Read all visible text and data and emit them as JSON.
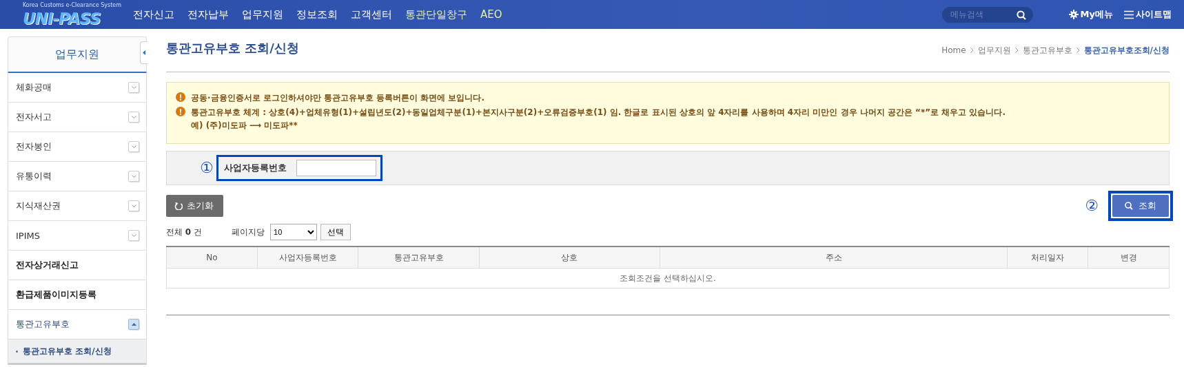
{
  "header": {
    "logo": {
      "tagline": "Korea Customs e-Clearance System",
      "name": "UNI-PASS"
    },
    "nav": [
      {
        "label": "전자신고",
        "highlight": false
      },
      {
        "label": "전자납부",
        "highlight": false
      },
      {
        "label": "업무지원",
        "highlight": false
      },
      {
        "label": "정보조회",
        "highlight": false
      },
      {
        "label": "고객센터",
        "highlight": false
      },
      {
        "label": "통관단일창구",
        "highlight": true
      },
      {
        "label": "AEO",
        "highlight": true
      }
    ],
    "search": {
      "placeholder": "메뉴검색"
    },
    "my_menu": "My메뉴",
    "sitemap": "사이트맵"
  },
  "sidebar": {
    "title": "업무지원",
    "items": [
      {
        "label": "체화공매",
        "kind": "expandable",
        "expanded": false
      },
      {
        "label": "전자서고",
        "kind": "expandable",
        "expanded": false
      },
      {
        "label": "전자봉인",
        "kind": "expandable",
        "expanded": false
      },
      {
        "label": "유통이력",
        "kind": "expandable",
        "expanded": false
      },
      {
        "label": "지식재산권",
        "kind": "expandable",
        "expanded": false
      },
      {
        "label": "IPIMS",
        "kind": "expandable",
        "expanded": false
      },
      {
        "label": "전자상거래신고",
        "kind": "link"
      },
      {
        "label": "환급제품이미지등록",
        "kind": "link"
      },
      {
        "label": "통관고유부호",
        "kind": "expandable",
        "expanded": true,
        "children": [
          {
            "label": "통관고유부호 조회/신청",
            "selected": true
          }
        ]
      }
    ]
  },
  "page": {
    "title": "통관고유부호 조회/신청",
    "breadcrumb": [
      {
        "label": "Home",
        "current": false
      },
      {
        "label": "업무지원",
        "current": false
      },
      {
        "label": "통관고유부호",
        "current": false
      },
      {
        "label": "통관고유부호조회/신청",
        "current": true
      }
    ],
    "notices": [
      {
        "lines": [
          "공동·금융인증서로 로그인하셔야만 통관고유부호 등록버튼이 화면에 보입니다."
        ]
      },
      {
        "lines": [
          "통관고유부호 체계 : 상호(4)+업체유형(1)+설립년도(2)+동일업체구분(1)+본지사구분(2)+오류검증부호(1) 임. 한글로 표시된 상호의 앞 4자리를 사용하며 4자리 미만인 경우 나머지 공간은 “*”로 채우고 있습니다.",
          "예) (주)미도파 ⟶ 미도파**"
        ]
      }
    ],
    "search_form": {
      "marker": "①",
      "label": "사업자등록번호"
    },
    "reset_button": "초기화",
    "search_marker": "②",
    "search_button": "조회",
    "total": "전체 **0** 건",
    "per_page_label": "페이지당",
    "per_page_value": "10",
    "select_button": "선택",
    "table": {
      "columns": [
        "No",
        "사업자등록번호",
        "통관고유부호",
        "상호",
        "주소",
        "처리일자",
        "변경"
      ],
      "empty_message": "조회조건을 선택하십시오."
    }
  }
}
